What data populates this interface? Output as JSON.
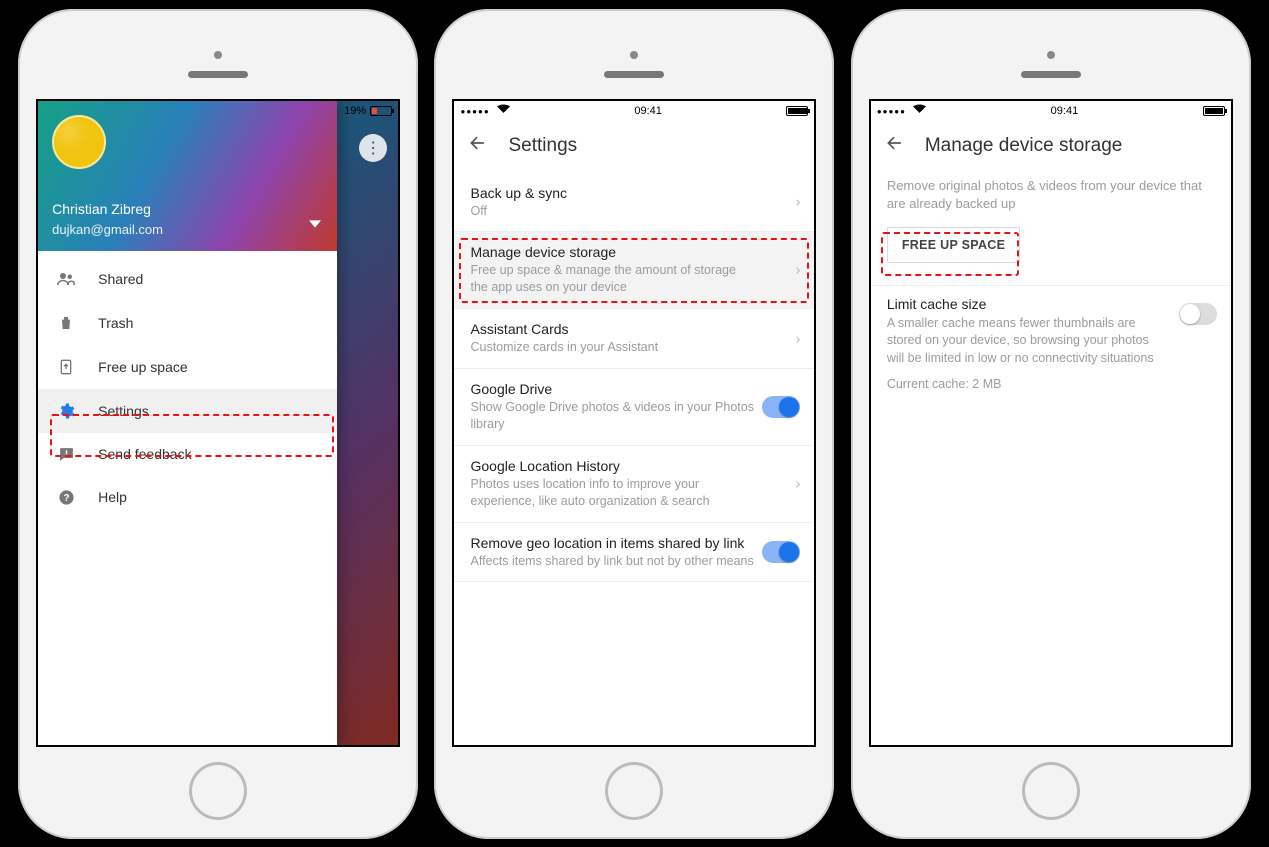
{
  "screen1": {
    "status": {
      "battery_pct": "19%"
    },
    "kebab": "⋮",
    "header": {
      "name": "Christian Zibreg",
      "email": "dujkan@gmail.com"
    },
    "items": [
      {
        "icon": "people-icon",
        "label": "Shared"
      },
      {
        "icon": "trash-icon",
        "label": "Trash"
      },
      {
        "icon": "freeup-icon",
        "label": "Free up space"
      },
      {
        "icon": "gear-icon",
        "label": "Settings"
      },
      {
        "icon": "feedback-icon",
        "label": "Send feedback"
      },
      {
        "icon": "help-icon",
        "label": "Help"
      }
    ]
  },
  "screen2": {
    "status": {
      "time": "09:41"
    },
    "title": "Settings",
    "rows": [
      {
        "title": "Back up & sync",
        "sub": "Off",
        "acc": "chev"
      },
      {
        "title": "Manage device storage",
        "sub": "Free up space & manage the amount of storage the app uses on your device",
        "acc": "chev",
        "selected": true
      },
      {
        "title": "Assistant Cards",
        "sub": "Customize cards in your Assistant",
        "acc": "chev"
      },
      {
        "title": "Google Drive",
        "sub": "Show Google Drive photos & videos in your Photos library",
        "acc": "toggle-on"
      },
      {
        "title": "Google Location History",
        "sub": "Photos uses location info to improve your experience, like auto organization & search",
        "acc": "chev"
      },
      {
        "title": "Remove geo location in items shared by link",
        "sub": "Affects items shared by link but not by other means",
        "acc": "toggle-on"
      }
    ]
  },
  "screen3": {
    "status": {
      "time": "09:41"
    },
    "title": "Manage device storage",
    "help": "Remove original photos & videos from your device that are already backed up",
    "button": "FREE UP SPACE",
    "cache": {
      "title": "Limit cache size",
      "sub": "A smaller cache means fewer thumbnails are stored on your device, so browsing your photos will be limited in low or no connectivity situations",
      "current": "Current cache: 2 MB"
    }
  }
}
